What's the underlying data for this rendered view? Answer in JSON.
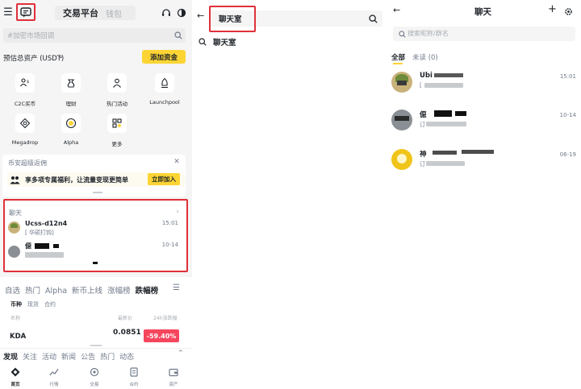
{
  "p1": {
    "header": {
      "tab_active": "交易平台",
      "tab_inactive": "钱包"
    },
    "search": {
      "placeholder": "#加密市场回调"
    },
    "assets": {
      "label": "预估总资产 (USDT)",
      "button": "添加资金"
    },
    "shortcuts": [
      "C2C买币",
      "理财",
      "热门活动",
      "Launchpool",
      "Megadrop",
      "Alpha",
      "更多"
    ],
    "vip": {
      "title": "币安超级返佣",
      "text": "享多项专属福利，让流量变现更简单",
      "button": "立即加入"
    },
    "chat_card": {
      "title": "聊天",
      "items": [
        {
          "name": "Ucss-d12n4",
          "preview": "[  华硕打钩]",
          "time": "15:01"
        },
        {
          "name": "僫",
          "preview": "",
          "time": "10-14"
        }
      ]
    },
    "market": {
      "tabs": [
        "自选",
        "热门",
        "Alpha",
        "新币上线",
        "涨幅榜",
        "跌幅榜"
      ],
      "subtabs": [
        "币种",
        "现货",
        "合约"
      ],
      "cols": [
        "名称",
        "最新价",
        "24h涨跌幅"
      ],
      "row": {
        "symbol": "KDA",
        "price": "0.0851",
        "change": "-59.40%"
      }
    },
    "feed_tabs": [
      "发现",
      "关注",
      "活动",
      "新闻",
      "公告",
      "热门",
      "动态"
    ],
    "bottom_nav": [
      "首页",
      "行情",
      "交易",
      "合约",
      "资产"
    ]
  },
  "p2": {
    "search": {
      "value": "聊天室"
    },
    "result": "聊天室"
  },
  "p3": {
    "title": "聊天",
    "search": {
      "placeholder": "搜索昵称/群名"
    },
    "tabs": {
      "all": "全部",
      "unread": "未读 (0)"
    },
    "items": [
      {
        "name": "Ubi",
        "preview": "[",
        "time": "15:01"
      },
      {
        "name": "僫",
        "preview": "订",
        "time": "10-14"
      },
      {
        "name": "神",
        "preview": "订",
        "time": "06-19"
      }
    ]
  },
  "colors": {
    "brand": "#fcd535",
    "red": "#e0303a",
    "down": "#f6465d"
  }
}
